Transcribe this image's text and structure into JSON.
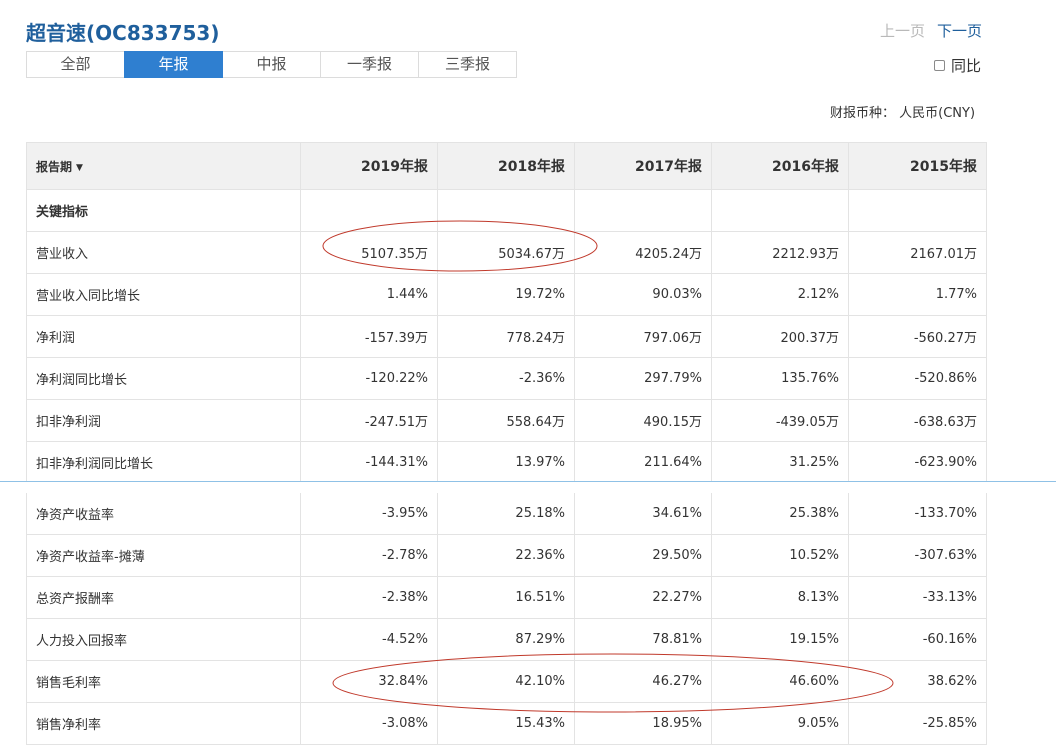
{
  "header": {
    "title": "超音速(OC833753)",
    "prev_page": "上一页",
    "next_page": "下一页",
    "yoy_label": "同比",
    "currency": "财报币种： 人民币(CNY)"
  },
  "tabs": [
    {
      "label": "全部",
      "active": false
    },
    {
      "label": "年报",
      "active": true
    },
    {
      "label": "中报",
      "active": false
    },
    {
      "label": "一季报",
      "active": false
    },
    {
      "label": "三季报",
      "active": false
    }
  ],
  "table": {
    "period_label": "报告期",
    "sort_icon": "caret-down-icon",
    "columns": [
      "2019年报",
      "2018年报",
      "2017年报",
      "2016年报",
      "2015年报"
    ],
    "section_label": "关键指标",
    "rows": [
      {
        "label": "营业收入",
        "values": [
          "5107.35万",
          "5034.67万",
          "4205.24万",
          "2212.93万",
          "2167.01万"
        ]
      },
      {
        "label": "营业收入同比增长",
        "values": [
          "1.44%",
          "19.72%",
          "90.03%",
          "2.12%",
          "1.77%"
        ]
      },
      {
        "label": "净利润",
        "values": [
          "-157.39万",
          "778.24万",
          "797.06万",
          "200.37万",
          "-560.27万"
        ]
      },
      {
        "label": "净利润同比增长",
        "values": [
          "-120.22%",
          "-2.36%",
          "297.79%",
          "135.76%",
          "-520.86%"
        ]
      },
      {
        "label": "扣非净利润",
        "values": [
          "-247.51万",
          "558.64万",
          "490.15万",
          "-439.05万",
          "-638.63万"
        ]
      },
      {
        "label": "扣非净利润同比增长",
        "values": [
          "-144.31%",
          "13.97%",
          "211.64%",
          "31.25%",
          "-623.90%"
        ]
      },
      {
        "label": "净资产收益率",
        "values": [
          "-3.95%",
          "25.18%",
          "34.61%",
          "25.38%",
          "-133.70%"
        ]
      },
      {
        "label": "净资产收益率-摊薄",
        "values": [
          "-2.78%",
          "22.36%",
          "29.50%",
          "10.52%",
          "-307.63%"
        ]
      },
      {
        "label": "总资产报酬率",
        "values": [
          "-2.38%",
          "16.51%",
          "22.27%",
          "8.13%",
          "-33.13%"
        ]
      },
      {
        "label": "人力投入回报率",
        "values": [
          "-4.52%",
          "87.29%",
          "78.81%",
          "19.15%",
          "-60.16%"
        ]
      },
      {
        "label": "销售毛利率",
        "values": [
          "32.84%",
          "42.10%",
          "46.27%",
          "46.60%",
          "38.62%"
        ]
      },
      {
        "label": "销售净利率",
        "values": [
          "-3.08%",
          "15.43%",
          "18.95%",
          "9.05%",
          "-25.85%"
        ]
      }
    ]
  },
  "colors": {
    "title": "#1f5f9c",
    "tab_active": "#2f7fd0",
    "annotation": "#c0392b",
    "header_bg": "#f1f1f1"
  }
}
